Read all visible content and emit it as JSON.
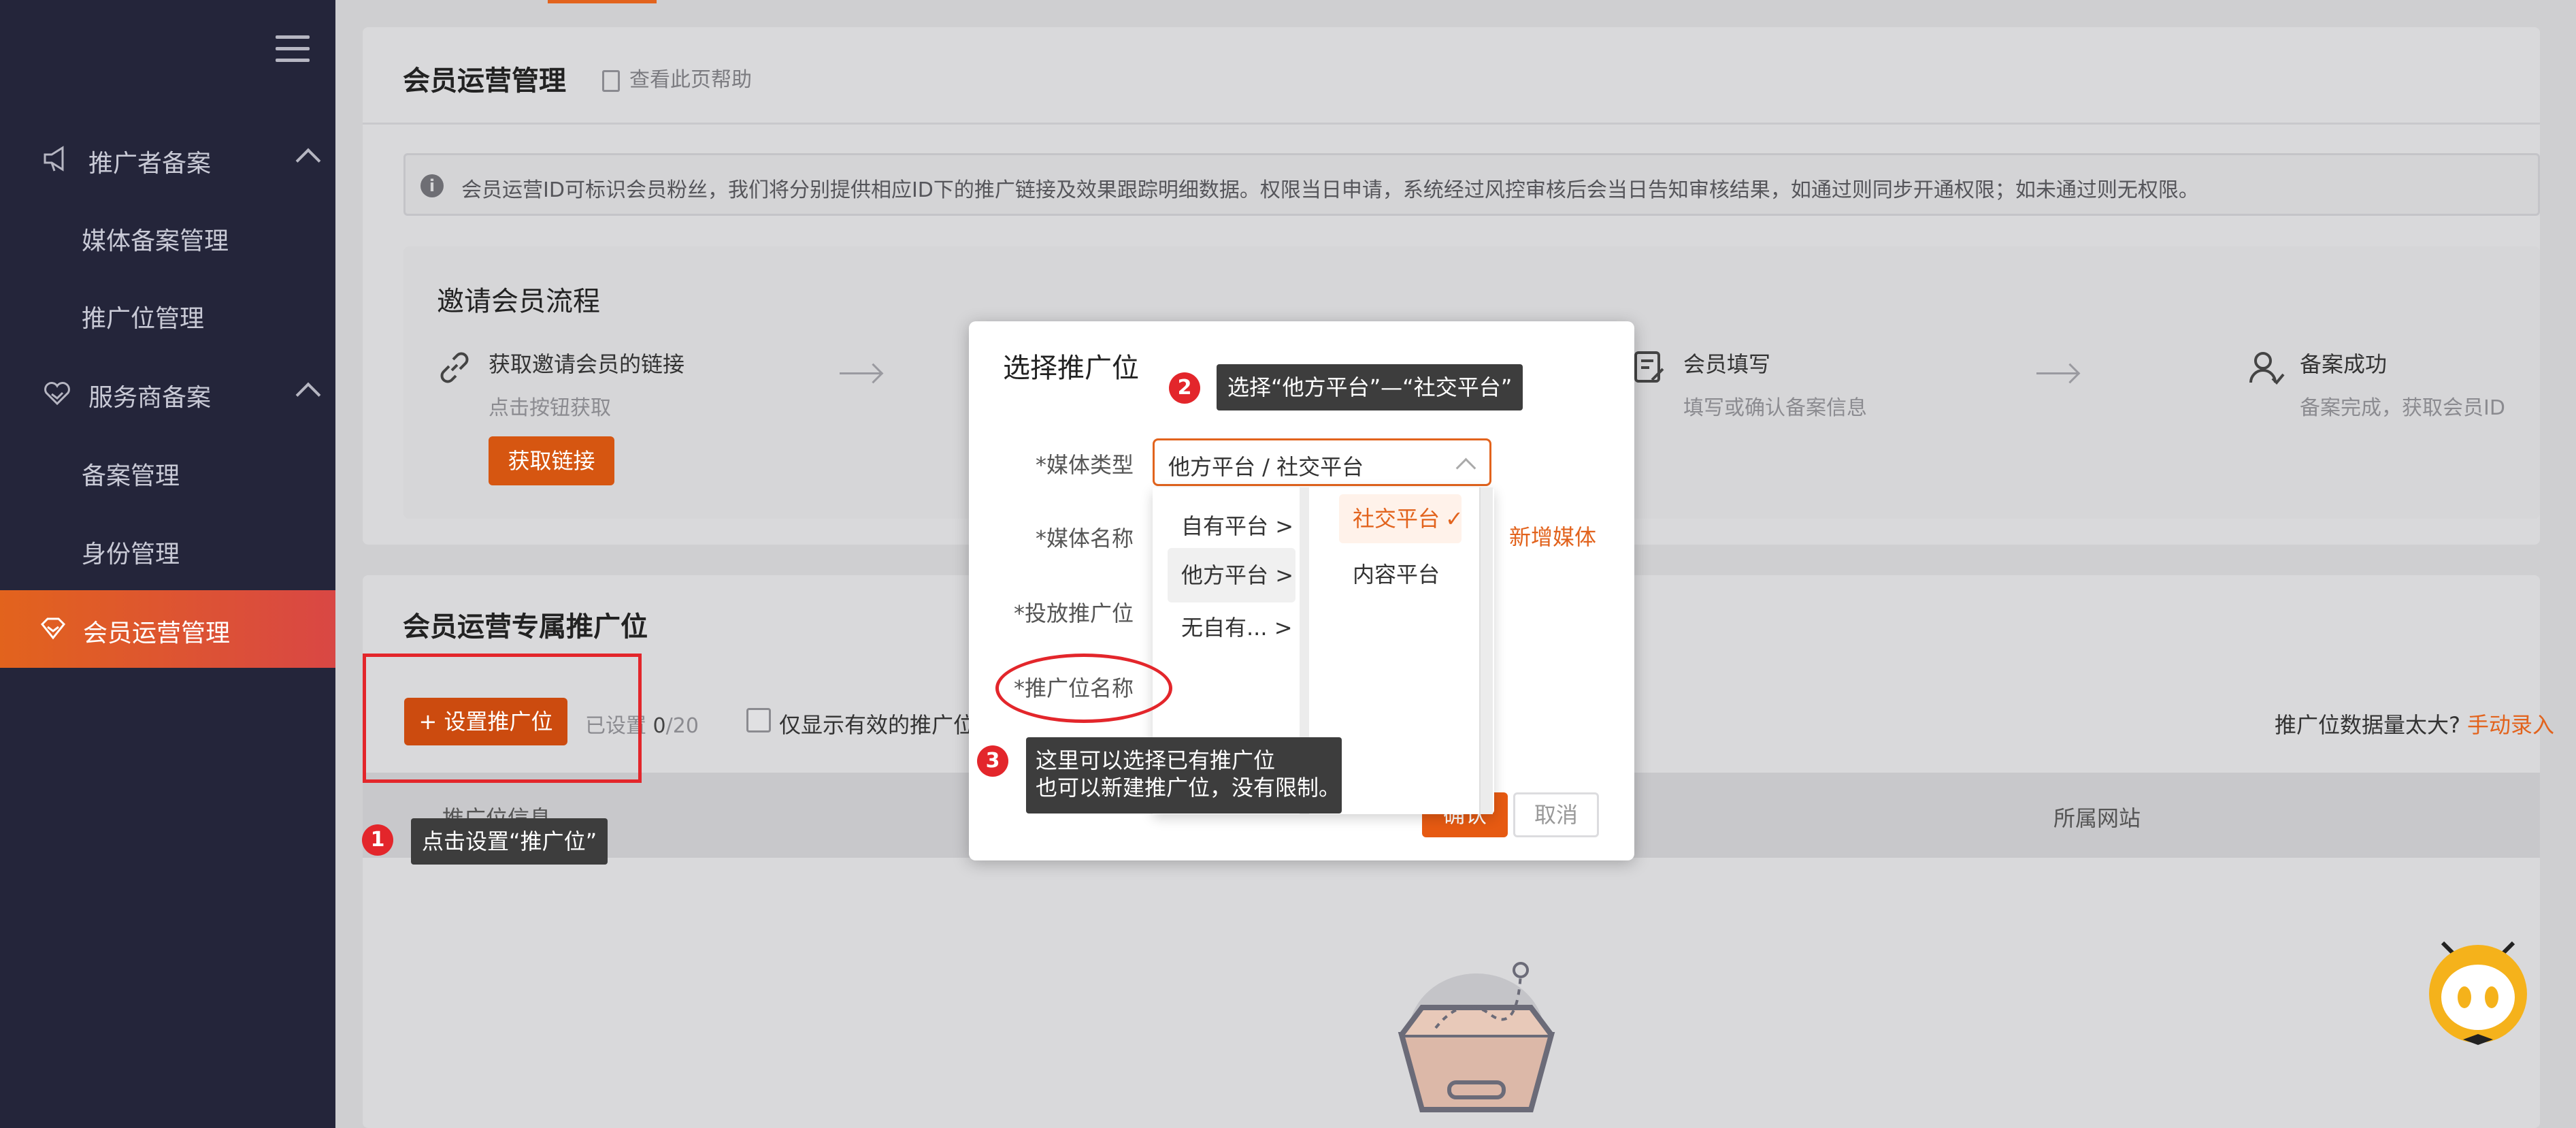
{
  "sidebar": {
    "groups": [
      {
        "label": "推广者备案",
        "icon": "megaphone-icon"
      },
      {
        "label": "服务商备案",
        "icon": "heart-hand-icon"
      }
    ],
    "items": [
      "媒体备案管理",
      "推广位管理",
      "备案管理",
      "身份管理"
    ],
    "active": {
      "label": "会员运营管理",
      "icon": "diamond-icon"
    }
  },
  "header": {
    "title": "会员运营管理",
    "help": "查看此页帮助"
  },
  "notice": "会员运营ID可标识会员粉丝，我们将分别提供相应ID下的推广链接及效果跟踪明细数据。权限当日申请，系统经过风控审核后会当日告知审核结果，如通过则同步开通权限；如未通过则无权限。",
  "flow": {
    "title": "邀请会员流程",
    "steps": [
      {
        "title": "获取邀请会员的链接",
        "desc": "点击按钮获取",
        "button": "获取链接",
        "icon": "link-icon"
      },
      {
        "title": "会员填写",
        "desc": "填写或确认备案信息",
        "icon": "form-edit-icon"
      },
      {
        "title": "备案成功",
        "desc": "备案完成，获取会员ID",
        "icon": "user-check-icon"
      }
    ]
  },
  "section": {
    "title": "会员运营专属推广位",
    "set_button": "+ 设置推广位",
    "set_count_label": "已设置",
    "set_count_value": "0",
    "set_count_max": "/20",
    "valid_only": "仅显示有效的推广位",
    "big_data_text": "推广位数据量太大?",
    "big_data_link": "手动录入",
    "columns": [
      "推广位信息",
      "所属网站"
    ]
  },
  "modal": {
    "title": "选择推广位",
    "labels": [
      "*媒体类型",
      "*媒体名称",
      "*投放推广位",
      "*推广位名称"
    ],
    "media_type_value": "他方平台 / 社交平台",
    "cascader_col1": [
      "自有平台",
      "他方平台",
      "无自有..."
    ],
    "cascader_col2": [
      "社交平台",
      "内容平台"
    ],
    "add_media": "新增媒体",
    "confirm": "确认",
    "cancel": "取消"
  },
  "annotations": [
    {
      "num": "1",
      "text": "点击设置“推广位”"
    },
    {
      "num": "2",
      "text": "选择“他方平台”—“社交平台”"
    },
    {
      "num": "3",
      "text_lines": [
        "这里可以选择已有推广位",
        "也可以新建推广位，没有限制。"
      ]
    }
  ],
  "colors": {
    "accent": "#e2631d",
    "sidebar": "#24253a",
    "annotation": "#e3262b"
  }
}
